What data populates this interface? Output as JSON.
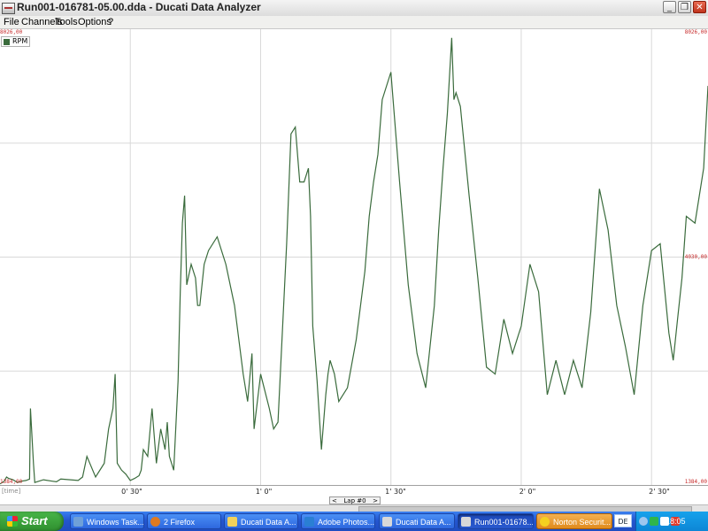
{
  "window": {
    "title": "Run001-016781-05.00.dda - Ducati Data Analyzer"
  },
  "menu": [
    "File",
    "Channels",
    "Tools",
    "Options",
    "?"
  ],
  "plot": {
    "y_max_label": "8026,00",
    "y_mid_label": "4030,00",
    "y_min_label": "1384,00",
    "time_unit": "[time]",
    "lap_label": "Lap #0",
    "lap_prev": "<",
    "lap_next": ">",
    "line_color": "#3a6b3c"
  },
  "chart_data": {
    "type": "line",
    "ylim": [
      1384,
      8026
    ],
    "x_domain": [
      0,
      163
    ],
    "x_ticks": [
      {
        "value": 30,
        "label": "0' 30\""
      },
      {
        "value": 60,
        "label": "1' 0\""
      },
      {
        "value": 90,
        "label": "1' 30\""
      },
      {
        "value": 120,
        "label": "2' 0\""
      },
      {
        "value": 150,
        "label": "2' 30\""
      }
    ],
    "series": [
      {
        "name": "RPM",
        "x": [
          0,
          1,
          1.5,
          2,
          3,
          4,
          5,
          6,
          6.8,
          7,
          7.7,
          8,
          10,
          12,
          13,
          14,
          18,
          19,
          20,
          22,
          24,
          25,
          26,
          26.5,
          27,
          28,
          29,
          30,
          31,
          32,
          32.5,
          33,
          34,
          35,
          36,
          37,
          38,
          38.5,
          39,
          40,
          41,
          41.5,
          42,
          42.5,
          43,
          44,
          45,
          45.5,
          46,
          47,
          48,
          50,
          52,
          54,
          56,
          57,
          58,
          58.5,
          60,
          62,
          63,
          64,
          65,
          66,
          67,
          68,
          69,
          70,
          71,
          71.5,
          72,
          73,
          74,
          75,
          75.5,
          76,
          77,
          78,
          80,
          82,
          84,
          85,
          86,
          87,
          88,
          90,
          92,
          94,
          96,
          98,
          100,
          101,
          102,
          103,
          104,
          104.5,
          105,
          106,
          108,
          110,
          112,
          114,
          116,
          118,
          120,
          122,
          124,
          126,
          128,
          130,
          132,
          134,
          136,
          138,
          140,
          142,
          144,
          146,
          148,
          150,
          152,
          154,
          155,
          156,
          157,
          158,
          160,
          162,
          163
        ],
        "values": [
          1400,
          1440,
          1500,
          1480,
          1460,
          1420,
          1440,
          1450,
          1470,
          2500,
          1700,
          1420,
          1460,
          1440,
          1430,
          1470,
          1450,
          1500,
          1800,
          1500,
          1700,
          2200,
          2500,
          3000,
          1700,
          1600,
          1540,
          1450,
          1480,
          1520,
          1600,
          1900,
          1800,
          2500,
          1700,
          2200,
          1900,
          2300,
          1800,
          1600,
          2900,
          4200,
          5200,
          5600,
          4300,
          4600,
          4400,
          4000,
          4000,
          4600,
          4800,
          5000,
          4600,
          4000,
          3000,
          2600,
          3300,
          2200,
          3000,
          2500,
          2200,
          2300,
          3600,
          4900,
          6500,
          6600,
          5800,
          5800,
          6000,
          5300,
          3700,
          2900,
          1900,
          2700,
          3000,
          3200,
          3000,
          2600,
          2800,
          3500,
          4500,
          5300,
          5800,
          6200,
          7000,
          7400,
          5800,
          4300,
          3300,
          2800,
          4000,
          5100,
          6000,
          6800,
          7900,
          7000,
          7100,
          6900,
          5600,
          4400,
          3100,
          3000,
          3800,
          3300,
          3700,
          4600,
          4200,
          2700,
          3200,
          2700,
          3200,
          2800,
          3900,
          5700,
          5100,
          4000,
          3400,
          2700,
          4000,
          4800,
          4900,
          3600,
          3200,
          3800,
          4400,
          5300,
          5200,
          6000,
          7200
        ]
      }
    ]
  },
  "taskbar": {
    "start_label": "Start",
    "tasks": [
      {
        "label": "Windows Task...",
        "icon_color": "#6fa0d8"
      },
      {
        "label": "2 Firefox",
        "icon_color": "#e07a20"
      },
      {
        "label": "Ducati Data A...",
        "icon_color": "#f2d15a"
      },
      {
        "label": "Adobe Photos...",
        "icon_color": "#2a7fd4"
      },
      {
        "label": "Ducati Data A...",
        "icon_color": "#d8d8d8"
      },
      {
        "label": "Run001-01678...",
        "icon_color": "#d8d8d8"
      },
      {
        "label": "Norton Securit...",
        "icon_color": "#f5d020"
      }
    ],
    "language": "DE",
    "clock": "18:05"
  },
  "colors": {
    "accent": "#2456cf",
    "axis_label": "#c62828",
    "grid": "#d9d9d9"
  }
}
